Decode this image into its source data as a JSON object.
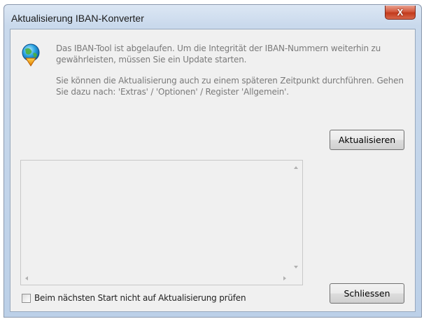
{
  "window": {
    "title": "Aktualisierung IBAN-Konverter",
    "close_label": "X"
  },
  "message": {
    "icon": "update-globe-icon",
    "line1": "Das IBAN-Tool ist abgelaufen. Um die Integrität der IBAN-Nummern weiterhin zu gewährleisten, müssen Sie ein Update starten.",
    "line2": "Sie können die Aktualisierung auch zu einem späteren Zeitpunkt durchführen. Gehen Sie dazu nach: 'Extras' / 'Optionen' / Register 'Allgemein'."
  },
  "buttons": {
    "update": "Aktualisieren",
    "close": "Schliessen"
  },
  "checkbox": {
    "label": "Beim nächsten Start nicht auf Aktualisierung prüfen",
    "checked": false
  },
  "log": {
    "text": ""
  },
  "colors": {
    "accent": "#c23a1c",
    "frame": "#bcd0e8",
    "client": "#f0f0f0"
  }
}
